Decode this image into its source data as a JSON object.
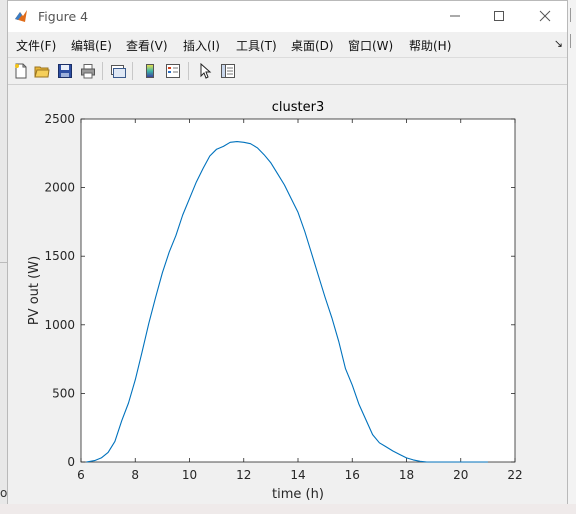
{
  "window": {
    "title": "Figure 4",
    "controls": [
      "—",
      "☐",
      "✕"
    ]
  },
  "menu": {
    "items": [
      "文件(F)",
      "编辑(E)",
      "查看(V)",
      "插入(I)",
      "工具(T)",
      "桌面(D)",
      "窗口(W)",
      "帮助(H)"
    ],
    "overflow": "↘"
  },
  "toolbar": {
    "icons": [
      "new-figure-icon",
      "open-file-icon",
      "save-icon",
      "print-icon",
      "link-plot-icon",
      "colorbar-icon",
      "legend-icon",
      "pointer-icon",
      "property-editor-icon"
    ]
  },
  "background": {
    "bottom_glyph": "o"
  },
  "chart_data": {
    "type": "line",
    "title": "cluster3",
    "xlabel": "time (h)",
    "ylabel": "PV out (W)",
    "xlim": [
      6,
      22
    ],
    "ylim": [
      0,
      2500
    ],
    "xticks": [
      6,
      8,
      10,
      12,
      14,
      16,
      18,
      20,
      22
    ],
    "yticks": [
      0,
      500,
      1000,
      1500,
      2000,
      2500
    ],
    "grid": false,
    "line_color": "#0072BD",
    "series": [
      {
        "x": [
          6.2,
          6.5,
          6.75,
          7.0,
          7.25,
          7.5,
          7.75,
          8.0,
          8.25,
          8.5,
          8.75,
          9.0,
          9.25,
          9.5,
          9.75,
          10.0,
          10.25,
          10.5,
          10.75,
          11.0,
          11.25,
          11.5,
          11.75,
          12.0,
          12.25,
          12.5,
          12.75,
          13.0,
          13.25,
          13.5,
          13.75,
          14.0,
          14.25,
          14.5,
          14.75,
          15.0,
          15.25,
          15.5,
          15.75,
          16.0,
          16.25,
          16.5,
          16.75,
          17.0,
          17.25,
          17.5,
          17.75,
          18.0,
          18.25,
          18.5,
          18.75,
          19.0,
          19.25,
          19.5,
          19.75,
          20.0,
          20.25,
          20.5,
          20.75,
          21.0
        ],
        "y": [
          0,
          10,
          30,
          70,
          150,
          300,
          430,
          600,
          800,
          1010,
          1200,
          1380,
          1530,
          1650,
          1800,
          1920,
          2040,
          2140,
          2230,
          2280,
          2300,
          2330,
          2335,
          2330,
          2320,
          2290,
          2240,
          2180,
          2100,
          2020,
          1920,
          1820,
          1680,
          1520,
          1360,
          1200,
          1050,
          880,
          680,
          560,
          420,
          310,
          200,
          140,
          110,
          80,
          55,
          30,
          15,
          5,
          0,
          0,
          0,
          0,
          0,
          0,
          0,
          0,
          0,
          0
        ]
      }
    ]
  }
}
